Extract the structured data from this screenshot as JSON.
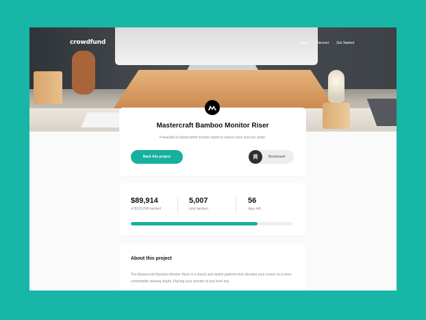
{
  "nav": {
    "logo": "crowdfund",
    "links": [
      "About",
      "Discover",
      "Get Started"
    ]
  },
  "project": {
    "title": "Mastercraft Bamboo Monitor Riser",
    "description": "A beautiful & handcrafted monitor stand to reduce neck and eye strain.",
    "back_label": "Back this project",
    "bookmark_label": "Bookmark"
  },
  "stats": {
    "backed_amount": "$89,914",
    "backed_label": "of $100,000 backed",
    "backers": "5,007",
    "backers_label": "total backers",
    "days": "56",
    "days_label": "days left",
    "progress_fraction": 0.78
  },
  "about": {
    "heading": "About this project",
    "text": "The Mastercraft Bamboo Monitor Riser is a sturdy and stylish platform that elevates your screen to a more comfortable viewing height. Placing your monitor at eye level has"
  },
  "colors": {
    "accent": "#16b09f",
    "background": "#17b6a6"
  }
}
